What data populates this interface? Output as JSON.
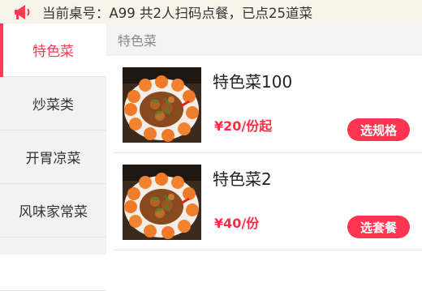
{
  "notice": {
    "text": "当前桌号：A99 共2人扫码点餐，已点25道菜"
  },
  "categories": [
    {
      "label": "特色菜",
      "active": true
    },
    {
      "label": "炒菜类",
      "active": false
    },
    {
      "label": "开胃凉菜",
      "active": false
    },
    {
      "label": "风味家常菜",
      "active": false
    },
    {
      "label": "",
      "active": false
    }
  ],
  "section": {
    "title": "特色菜"
  },
  "dishes": [
    {
      "name": "特色菜100",
      "price": "¥20/份起",
      "button": "选规格"
    },
    {
      "name": "特色菜2",
      "price": "¥40/份",
      "button": "选套餐"
    }
  ],
  "colors": {
    "accent": "#ff3a52",
    "notice_bg": "#f7f4ea",
    "sidebar_bg": "#f2f2f2"
  }
}
